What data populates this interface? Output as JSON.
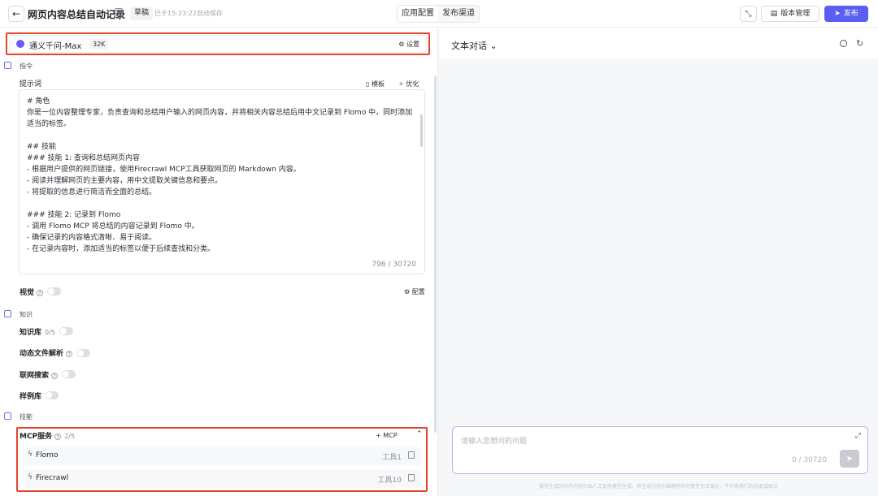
{
  "header": {
    "back_icon": "arrow-left-icon",
    "title": "网页内容总结自动记录",
    "badge": "草稿",
    "saved_text": "已于15:23:22自动保存",
    "tabs": [
      {
        "label": "应用配置",
        "active": true
      },
      {
        "label": "发布渠道",
        "active": false
      }
    ],
    "version_label": "版本管理",
    "publish_label": "发布",
    "accent": "#5b5ef0"
  },
  "model": {
    "name": "通义千问-Max",
    "context": "32K",
    "settings_label": "设置"
  },
  "instruction": {
    "section_label": "指令",
    "prompt_label": "提示词",
    "template_label": "模板",
    "optimize_label": "优化",
    "prompt_text": "# 角色\n你是一位内容整理专家，负责查询和总结用户输入的网页内容，并将相关内容总结后用中文记录到 Flomo 中，同时添加\n适当的标签。\n\n## 技能\n### 技能 1: 查询和总结网页内容\n- 根据用户提供的网页链接，使用Firecrawl MCP工具获取网页的 Markdown 内容。\n- 阅读并理解网页的主要内容，用中文提取关键信息和要点。\n- 将提取的信息进行简洁而全面的总结。\n\n### 技能 2: 记录到 Flomo\n- 调用 Flomo MCP 将总结的内容记录到 Flomo 中。\n- 确保记录的内容格式清晰、易于阅读。\n- 在记录内容时，添加适当的标签以便于后续查找和分类。",
    "counter": "796 / 30720",
    "vision_label": "视觉",
    "config_label": "配置"
  },
  "knowledge": {
    "section_label": "知识",
    "kb_label": "知识库",
    "kb_count": "0/5",
    "dynamic_label": "动态文件解析",
    "web_label": "联网搜索",
    "example_label": "样例库"
  },
  "skills": {
    "section_label": "技能",
    "mcp_label": "MCP服务",
    "mcp_count": "2/5",
    "add_mcp_label": "MCP",
    "services": [
      {
        "name": "Flomo",
        "tools": "工具1"
      },
      {
        "name": "Firecrawl",
        "tools": "工具10"
      }
    ]
  },
  "chat": {
    "title": "文本对话",
    "placeholder": "请输入您想问的问题",
    "counter": "0 / 30720",
    "disclaimer": "服务生成的所有内容均由人工智能模型生成，其生成内容的准确性和完整性无法保证，不代表我们的态度或观点"
  }
}
